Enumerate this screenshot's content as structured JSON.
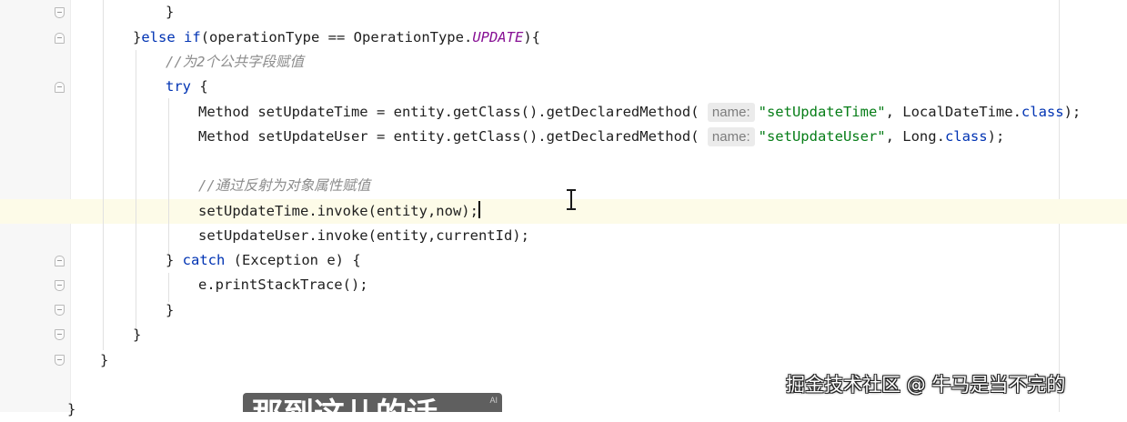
{
  "code": {
    "line_close_if_brace": "}",
    "else_if_prefix": "}",
    "else_kw": "else",
    "if_kw": "if",
    "else_if_mid": "(operationType == OperationType.",
    "update_const": "UPDATE",
    "else_if_end": "){",
    "comment_assign": "//为2个公共字段赋值",
    "try_kw": "try",
    "try_brace": " {",
    "m1_prefix": "Method setUpdateTime = entity.getClass().getDeclaredMethod(",
    "m1_hint": "name:",
    "m1_str": "\"setUpdateTime\"",
    "m1_mid": ", LocalDateTime.",
    "m1_class_kw": "class",
    "m1_end": ");",
    "m2_prefix": "Method setUpdateUser = entity.getClass().getDeclaredMethod(",
    "m2_hint": "name:",
    "m2_str": "\"setUpdateUser\"",
    "m2_mid": ", Long.",
    "m2_class_kw": "class",
    "m2_end": ");",
    "comment_reflect": "//通过反射为对象属性赋值",
    "invoke_time": "setUpdateTime.invoke(entity,now);",
    "invoke_user": "setUpdateUser.invoke(entity,currentId);",
    "catch_open": "} ",
    "catch_kw": "catch",
    "catch_rest": " (Exception e) {",
    "print_stack": "e.printStackTrace();",
    "close_catch": "}",
    "close_else": "}",
    "close_method": "}",
    "close_class_partial": "}"
  },
  "overlay": {
    "watermark": "掘金技术社区 @ 牛马是当不完的",
    "subtitle_partial": "那到这儿的话",
    "subtitle_badge": "AI"
  },
  "icons": {
    "fold_markers": "fold-marker-icon",
    "text_cursor": "ibeam-cursor-icon"
  },
  "colors": {
    "keyword": "#0033b3",
    "string": "#067d17",
    "constant": "#871094",
    "comment": "#8c8c8c",
    "current_line": "#fdfbe8"
  }
}
